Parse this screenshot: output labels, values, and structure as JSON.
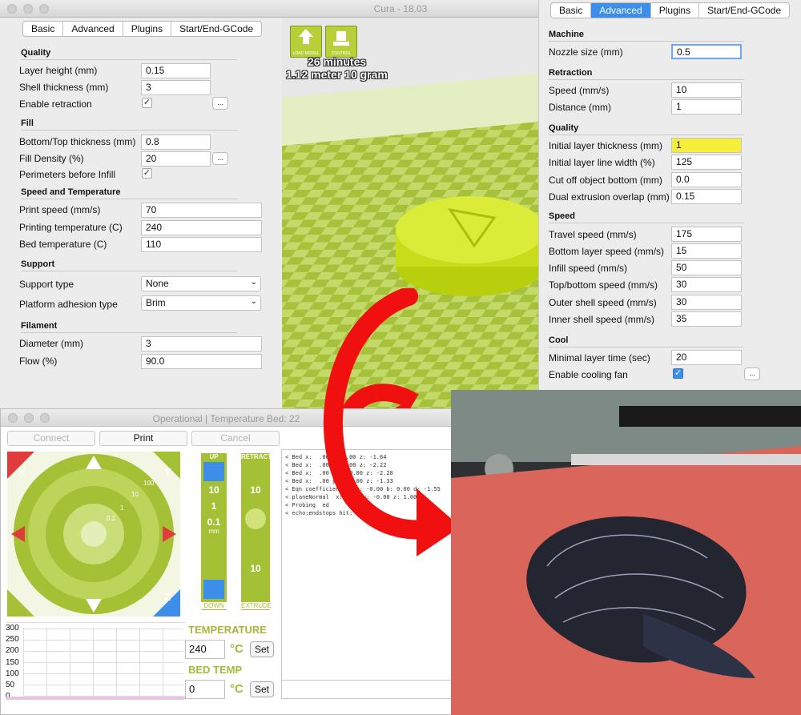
{
  "window": {
    "title": "Cura - 18.03"
  },
  "left_tabs": [
    "Basic",
    "Advanced",
    "Plugins",
    "Start/End-GCode"
  ],
  "basic": {
    "quality_title": "Quality",
    "layer_height_label": "Layer height (mm)",
    "layer_height": "0.15",
    "shell_label": "Shell thickness (mm)",
    "shell": "3",
    "retraction_label": "Enable retraction",
    "fill_title": "Fill",
    "bottomtop_label": "Bottom/Top thickness (mm)",
    "bottomtop": "0.8",
    "density_label": "Fill Density (%)",
    "density": "20",
    "perimeters_label": "Perimeters before Infill",
    "speed_title": "Speed and Temperature",
    "print_speed_label": "Print speed (mm/s)",
    "print_speed": "70",
    "print_temp_label": "Printing temperature (C)",
    "print_temp": "240",
    "bed_temp_label": "Bed temperature (C)",
    "bed_temp": "110",
    "support_title": "Support",
    "support_type_label": "Support type",
    "support_type": "None",
    "adhesion_label": "Platform adhesion type",
    "adhesion": "Brim",
    "filament_title": "Filament",
    "diameter_label": "Diameter (mm)",
    "diameter": "3",
    "flow_label": "Flow (%)",
    "flow": "90.0",
    "dots": "..."
  },
  "viewport": {
    "load_label": "LOAD MODEL",
    "control_label": "CONTROL",
    "time": "26 minutes",
    "material": "1.12 meter 10 gram"
  },
  "right_tabs": [
    "Basic",
    "Advanced",
    "Plugins",
    "Start/End-GCode"
  ],
  "advanced": {
    "machine_title": "Machine",
    "nozzle_label": "Nozzle size (mm)",
    "nozzle": "0.5",
    "retraction_title": "Retraction",
    "r_speed_label": "Speed (mm/s)",
    "r_speed": "10",
    "r_distance_label": "Distance (mm)",
    "r_distance": "1",
    "quality_title": "Quality",
    "init_thick_label": "Initial layer thickness (mm)",
    "init_thick": "1",
    "init_width_label": "Initial layer line width (%)",
    "init_width": "125",
    "cutoff_label": "Cut off object bottom (mm)",
    "cutoff": "0.0",
    "dual_label": "Dual extrusion overlap (mm)",
    "dual": "0.15",
    "speed_title": "Speed",
    "travel_label": "Travel speed (mm/s)",
    "travel": "175",
    "bottom_label": "Bottom layer speed (mm/s)",
    "bottom": "15",
    "infill_label": "Infill speed (mm/s)",
    "infill": "50",
    "topbottom_label": "Top/bottom speed (mm/s)",
    "topbottom": "30",
    "outer_label": "Outer shell speed (mm/s)",
    "outer": "30",
    "inner_label": "Inner shell speed (mm/s)",
    "inner": "35",
    "cool_title": "Cool",
    "minlayer_label": "Minimal layer time (sec)",
    "minlayer": "20",
    "fan_label": "Enable cooling fan",
    "dots": "..."
  },
  "operational": {
    "title": "Operational | Temperature    Bed: 22",
    "connect": "Connect",
    "print": "Print",
    "cancel": "Cancel",
    "jog": {
      "x_pos": "X",
      "x_neg": "X",
      "y_pos": "Y",
      "y_neg": "Y",
      "z_home": "Z",
      "ring_100": "100",
      "ring_10": "10",
      "ring_1": "1",
      "ring_01": "0.1"
    },
    "z_panel": {
      "up": "UP",
      "down": "DOWN",
      "v10a": "10",
      "v1a": "1",
      "v01": "0.1",
      "mm": "mm"
    },
    "e_panel": {
      "retract": "RETRACT",
      "extrude": "EXTRUDE",
      "v10a": "10",
      "v10b": "10"
    },
    "log": "< Bed x:  .00 y: 0.00 z: -1.64\n< Bed x:  .00 y: 0.00 z: -2.22\n< Bed x:  .00 y: 160.00 z: -2.28\n< Bed x:  .00 y: 160.00 z: -1.33\n< Eqn coefficients:  a: -0.00 b: 0.00 d: -1.55\n< planeNormal  x: 0.00 y: -0.00 z: 1.00\n< Probing  ed\n< echo:endstops hit:  Z:-1.33",
    "temp_title": "TEMPERATURE",
    "temp_value": "240",
    "bed_title": "BED TEMP",
    "bed_value": "0",
    "deg": "°C",
    "set": "Set",
    "graph_ticks": [
      "300",
      "250",
      "200",
      "150",
      "100",
      "50",
      "0"
    ]
  },
  "colors": {
    "accent": "#3d8ee8",
    "highlight": "#f6ef3a",
    "cura_green": "#a6c23a",
    "arrow_red": "#f01010"
  }
}
